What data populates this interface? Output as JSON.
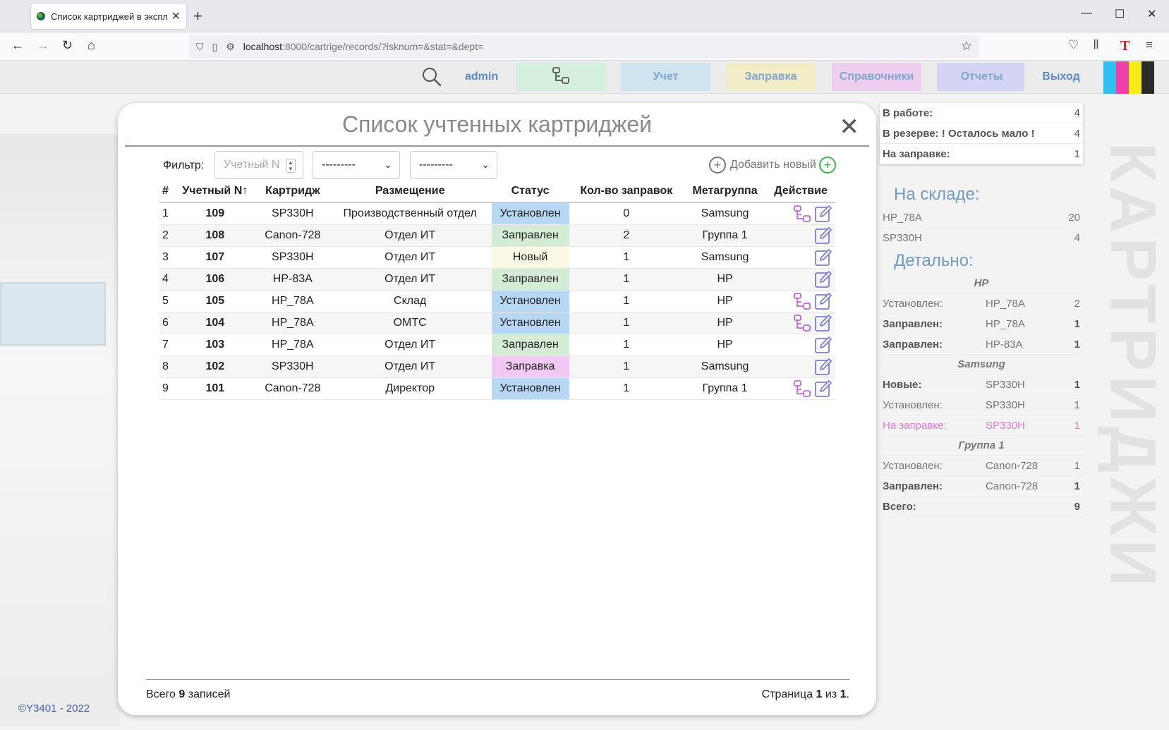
{
  "browser": {
    "tab_title": "Список картриджей в эксплуатации",
    "url_host": "localhost",
    "url_rest": ":8000/cartrige/records/?isknum=&stat=&dept="
  },
  "header": {
    "user": "admin",
    "buttons": [
      {
        "label": "",
        "icon": "transfer-icon",
        "bg": "#d4f0dc",
        "color": "#555555"
      },
      {
        "label": "Учет",
        "bg": "#cfe4f0",
        "color": "#7fa7cf"
      },
      {
        "label": "Заправка",
        "bg": "#f2ecc7",
        "color": "#7fa7cf"
      },
      {
        "label": "Справочники",
        "bg": "#efcff0",
        "color": "#7fa7cf"
      },
      {
        "label": "Отчеты",
        "bg": "#d4d4f4",
        "color": "#7fa7cf"
      },
      {
        "label": "Выход",
        "bg": "#ececec",
        "color": "#5b8cc8"
      }
    ],
    "stripe_colors": [
      "#2fc0f0",
      "#ef3fa8",
      "#f6ec1a",
      "#2a2a2a"
    ]
  },
  "modal": {
    "title": "Список учтенных картриджей",
    "filter_label": "Фильтр:",
    "number_placeholder": "Учетный N",
    "select1_value": "---------",
    "select2_value": "---------",
    "add_label": "Добавить новый",
    "columns": [
      "#",
      "Учетный N↑",
      "Картридж",
      "Размещение",
      "Статус",
      "Кол-во заправок",
      "Метагруппа",
      "Действие"
    ],
    "status_colors": {
      "Установлен": "#b8d7f4",
      "Заправлен": "#d4ecd4",
      "Новый": "#fbf9e6",
      "Заправка": "#f2c8f4"
    },
    "rows": [
      {
        "i": "1",
        "num": "109",
        "cart": "SP330H",
        "place": "Производственный отдел",
        "status": "Установлен",
        "refills": "0",
        "group": "Samsung",
        "transfer": true
      },
      {
        "i": "2",
        "num": "108",
        "cart": "Canon-728",
        "place": "Отдел ИТ",
        "status": "Заправлен",
        "refills": "2",
        "group": "Группа 1",
        "transfer": false
      },
      {
        "i": "3",
        "num": "107",
        "cart": "SP330H",
        "place": "Отдел ИТ",
        "status": "Новый",
        "refills": "1",
        "group": "Samsung",
        "transfer": false
      },
      {
        "i": "4",
        "num": "106",
        "cart": "HP-83A",
        "place": "Отдел ИТ",
        "status": "Заправлен",
        "refills": "1",
        "group": "HP",
        "transfer": false
      },
      {
        "i": "5",
        "num": "105",
        "cart": "HP_78A",
        "place": "Склад",
        "status": "Установлен",
        "refills": "1",
        "group": "HP",
        "transfer": true
      },
      {
        "i": "6",
        "num": "104",
        "cart": "HP_78A",
        "place": "ОМТС",
        "status": "Установлен",
        "refills": "1",
        "group": "HP",
        "transfer": true
      },
      {
        "i": "7",
        "num": "103",
        "cart": "HP_78A",
        "place": "Отдел ИТ",
        "status": "Заправлен",
        "refills": "1",
        "group": "HP",
        "transfer": false
      },
      {
        "i": "8",
        "num": "102",
        "cart": "SP330H",
        "place": "Отдел ИТ",
        "status": "Заправка",
        "refills": "1",
        "group": "Samsung",
        "transfer": false
      },
      {
        "i": "9",
        "num": "101",
        "cart": "Canon-728",
        "place": "Директор",
        "status": "Установлен",
        "refills": "1",
        "group": "Группа 1",
        "transfer": true
      }
    ],
    "footer_total_prefix": "Всего",
    "footer_total": "9",
    "footer_total_suffix": "записей",
    "footer_page_prefix": "Страница",
    "footer_page": "1",
    "footer_page_mid": "из",
    "footer_pages": "1"
  },
  "stats": [
    {
      "label": "В работе:",
      "value": "4",
      "pink": false
    },
    {
      "label": "В резерве: ! Осталось мало !",
      "value": "4",
      "pink": false
    },
    {
      "label": "На заправке:",
      "value": "1",
      "pink": true
    }
  ],
  "stock": {
    "title": "На складе:",
    "items": [
      {
        "name": "HP_78A",
        "count": "20"
      },
      {
        "name": "SP330H",
        "count": "4"
      }
    ]
  },
  "detail": {
    "title": "Детально:",
    "groups": [
      {
        "name": "HP",
        "rows": [
          {
            "status": "Установлен:",
            "cart": "HP_78A",
            "count": "2",
            "style": "normal"
          },
          {
            "status": "Заправлен:",
            "cart": "HP_78A",
            "count": "1",
            "style": "bold"
          },
          {
            "status": "Заправлен:",
            "cart": "HP-83A",
            "count": "1",
            "style": "bold"
          }
        ]
      },
      {
        "name": "Samsung",
        "rows": [
          {
            "status": "Новые:",
            "cart": "SP330H",
            "count": "1",
            "style": "bold"
          },
          {
            "status": "Установлен:",
            "cart": "SP330H",
            "count": "1",
            "style": "normal"
          },
          {
            "status": "На заправке:",
            "cart": "SP330H",
            "count": "1",
            "style": "pink"
          }
        ]
      },
      {
        "name": "Группа 1",
        "rows": [
          {
            "status": "Установлен:",
            "cart": "Canon-728",
            "count": "1",
            "style": "normal"
          },
          {
            "status": "Заправлен:",
            "cart": "Canon-728",
            "count": "1",
            "style": "bold"
          }
        ]
      }
    ],
    "total_label": "Всего:",
    "total_value": "9"
  },
  "bg": {
    "copyright": "©Y3401 - 2022",
    "vertical_text": "КАРТРИДЖИ"
  }
}
